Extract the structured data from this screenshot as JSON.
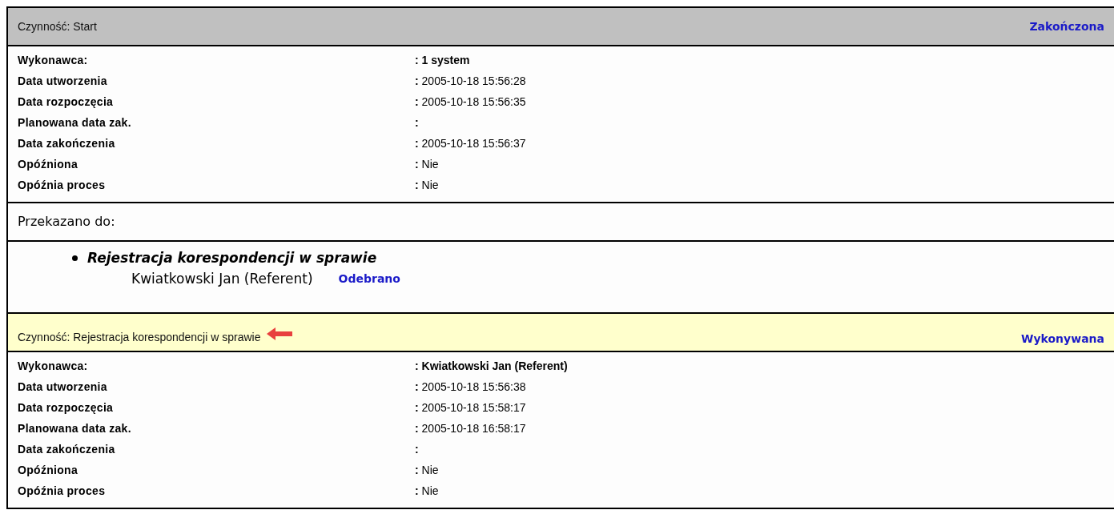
{
  "activities": [
    {
      "title": "Czynność: Start",
      "status": "Zakończona",
      "active": false,
      "arrow": false,
      "fields": [
        {
          "label": "Wykonawca:",
          "value": ": 1 system",
          "bold": true
        },
        {
          "label": "Data utworzenia",
          "value": "**:** 2005-10-18 15:56:28",
          "bold": false
        },
        {
          "label": "Data rozpoczęcia",
          "value": "**:** 2005-10-18 15:56:35",
          "bold": false
        },
        {
          "label": "Planowana data zak.",
          "value": ":",
          "bold": true
        },
        {
          "label": "Data zakończenia",
          "value": "**:** 2005-10-18 15:56:37",
          "bold": false
        },
        {
          "label": "Opóźniona",
          "value": "**:** Nie",
          "bold": false
        },
        {
          "label": "Opóźnia proces",
          "value": "**:** Nie",
          "bold": false
        }
      ],
      "forwarded": {
        "heading": "Przekazano do:",
        "items": [
          {
            "task": "Rejestracja korespondencji w sprawie",
            "person": "Kwiatkowski Jan (Referent)",
            "status": "Odebrano"
          }
        ]
      }
    },
    {
      "title": "Czynność: Rejestracja korespondencji w sprawie",
      "status": "Wykonywana",
      "active": true,
      "arrow": true,
      "fields": [
        {
          "label": "Wykonawca:",
          "value": ": Kwiatkowski Jan (Referent)",
          "bold": true
        },
        {
          "label": "Data utworzenia",
          "value": "**:** 2005-10-18 15:56:38",
          "bold": false
        },
        {
          "label": "Data rozpoczęcia",
          "value": "**:** 2005-10-18 15:58:17",
          "bold": false
        },
        {
          "label": "Planowana data zak.",
          "value": "**:** 2005-10-18 16:58:17",
          "bold": false
        },
        {
          "label": "Data zakończenia",
          "value": ":",
          "bold": true
        },
        {
          "label": "Opóźniona",
          "value": "**:** Nie",
          "bold": false
        },
        {
          "label": "Opóźnia proces",
          "value": "**:** Nie",
          "bold": false
        }
      ]
    }
  ]
}
